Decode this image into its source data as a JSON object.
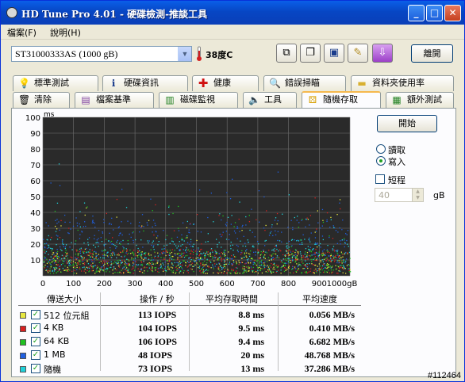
{
  "window": {
    "title": "HD Tune Pro 4.01 - 硬碟檢測-推談工具",
    "min": "_",
    "max": "□",
    "close": "✕"
  },
  "menu": {
    "file": "檔案(F)",
    "help": "說明(H)"
  },
  "toolbar": {
    "drive": "ST31000333AS (1000 gB)",
    "temperature": "38度C",
    "exit": "離開"
  },
  "tabs_row1": [
    {
      "label": "標準測試",
      "icon": "bulb-icon"
    },
    {
      "label": "硬碟資訊",
      "icon": "info-icon"
    },
    {
      "label": "健康",
      "icon": "health-cross-icon"
    },
    {
      "label": "錯誤掃瞄",
      "icon": "magnifier-icon"
    },
    {
      "label": "資料夾使用率",
      "icon": "folder-icon"
    }
  ],
  "tabs_row2": [
    {
      "label": "清除",
      "icon": "trash-icon"
    },
    {
      "label": "檔案基準",
      "icon": "file-benchmark-icon"
    },
    {
      "label": "磁碟監視",
      "icon": "monitor-chart-icon"
    },
    {
      "label": "工具",
      "icon": "speaker-icon"
    },
    {
      "label": "隨機存取",
      "icon": "random-access-icon"
    },
    {
      "label": "額外測試",
      "icon": "extra-tests-icon"
    }
  ],
  "active_tab": "隨機存取",
  "controls": {
    "start": "開始",
    "read": "讀取",
    "write": "寫入",
    "mode_selected": "write",
    "short_stroke": "短程",
    "short_stroke_checked": false,
    "short_value": "40",
    "short_unit": "gB"
  },
  "chart_data": {
    "type": "scatter",
    "ylabel": "ms",
    "xlabel": "gB",
    "ylim": [
      0,
      100
    ],
    "xlim": [
      0,
      1000
    ],
    "yticks": [
      "100",
      "90",
      "80",
      "70",
      "60",
      "50",
      "40",
      "30",
      "20",
      "10"
    ],
    "xticks": [
      "0",
      "100",
      "200",
      "300",
      "400",
      "500",
      "600",
      "700",
      "800",
      "900",
      "1000gB"
    ],
    "background": "#2a2a2a",
    "grid": true,
    "series": [
      {
        "name": "512 位元組",
        "color": "#e8e840",
        "typical_ms": 8.8
      },
      {
        "name": "4 KB",
        "color": "#d82020",
        "typical_ms": 9.5
      },
      {
        "name": "64 KB",
        "color": "#20c020",
        "typical_ms": 9.4
      },
      {
        "name": "1 MB",
        "color": "#2060e0",
        "typical_ms": 20
      },
      {
        "name": "隨機",
        "color": "#20d0d8",
        "typical_ms": 13
      }
    ]
  },
  "results": {
    "headers": [
      "傳送大小",
      "操作 / 秒",
      "平均存取時間",
      "平均速度"
    ],
    "rows": [
      {
        "size": "512 位元組",
        "iops": "113 IOPS",
        "time": "8.8 ms",
        "speed": "0.056 MB/s",
        "color": "#e8e840",
        "checked": true
      },
      {
        "size": "4 KB",
        "iops": "104 IOPS",
        "time": "9.5 ms",
        "speed": "0.410 MB/s",
        "color": "#d82020",
        "checked": true
      },
      {
        "size": "64 KB",
        "iops": "106 IOPS",
        "time": "9.4 ms",
        "speed": "6.682 MB/s",
        "color": "#20c020",
        "checked": true
      },
      {
        "size": "1 MB",
        "iops": "48 IOPS",
        "time": "20 ms",
        "speed": "48.768 MB/s",
        "color": "#2060e0",
        "checked": true
      },
      {
        "size": "隨機",
        "iops": "73 IOPS",
        "time": "13 ms",
        "speed": "37.286 MB/s",
        "color": "#20d0d8",
        "checked": true
      }
    ]
  },
  "watermark": "#112464"
}
